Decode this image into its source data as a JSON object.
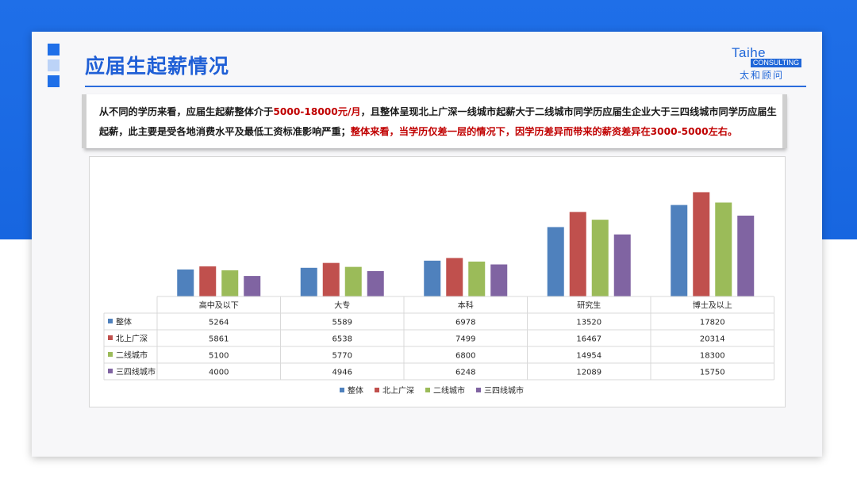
{
  "header": {
    "title": "应届生起薪情况",
    "logo": {
      "brand": "Taihe",
      "tag": "CONSULTING",
      "cn": "太和顾问"
    }
  },
  "summary": {
    "part1": "从不同的学历来看，应届生起薪整体介于",
    "part2": "5000-18000元/月",
    "part3": "，且整体呈现北上广深一线城市起薪大于二线城市同学历应届生企业大于三四线城市同学历应届生起薪，此主要是受各地消费水平及最低工资标准影响严重；",
    "part4": "整体来看，当学历仅差一层的情况下，因学历差异而带来的薪资差异在3000-5000左右。"
  },
  "colors": {
    "accent": "#1f6fe8",
    "highlight": "#c00000"
  },
  "chart_data": {
    "type": "bar",
    "categories": [
      "高中及以下",
      "大专",
      "本科",
      "研究生",
      "博士及以上"
    ],
    "series": [
      {
        "name": "整体",
        "color": "#4f81bd",
        "values": [
          5264,
          5589,
          6978,
          13520,
          17820
        ]
      },
      {
        "name": "北上广深",
        "color": "#c0504d",
        "values": [
          5861,
          6538,
          7499,
          16467,
          20314
        ]
      },
      {
        "name": "二线城市",
        "color": "#9bbb59",
        "values": [
          5100,
          5770,
          6800,
          14954,
          18300
        ]
      },
      {
        "name": "三四线城市",
        "color": "#8064a2",
        "values": [
          4000,
          4946,
          6248,
          12089,
          15750
        ]
      }
    ],
    "ylim": [
      0,
      21000
    ],
    "grid": false,
    "legend_position": "bottom",
    "data_table": true
  }
}
